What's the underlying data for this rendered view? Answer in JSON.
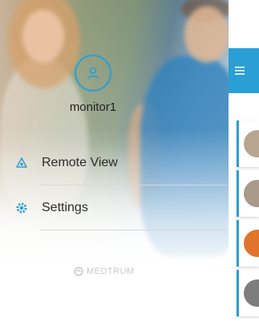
{
  "drawer": {
    "username": "monitor1",
    "menu": [
      {
        "label": "Remote View",
        "icon": "eye-icon"
      },
      {
        "label": "Settings",
        "icon": "gear-icon"
      }
    ],
    "brand": "MEDTRUM"
  },
  "main": {
    "appbar_icon": "menu-icon",
    "cards": [
      {
        "thumb_color": "#b7a58f"
      },
      {
        "thumb_color": "#a9998a"
      },
      {
        "thumb_color": "#e0742c"
      },
      {
        "thumb_color": "#7d7d7d"
      }
    ]
  },
  "colors": {
    "accent": "#2a9fd6",
    "text": "#2b2b2b",
    "brand": "#c9c9c9"
  }
}
